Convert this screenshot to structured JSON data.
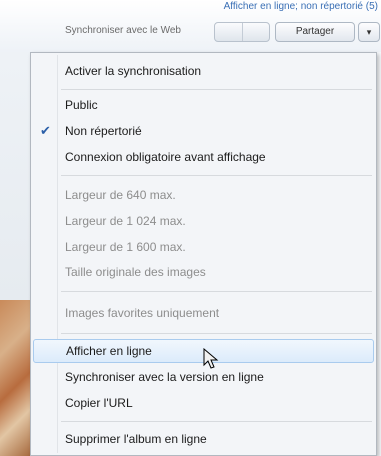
{
  "header": {
    "status_link": "Afficher en ligne; non répertorié (5)",
    "sync_label": "Synchroniser avec le Web",
    "share_button": "Partager",
    "dropdown_icon": "chevron-down-icon"
  },
  "menu": {
    "activate_sync": "Activer la synchronisation",
    "public": "Public",
    "unlisted": "Non répertorié",
    "login_required": "Connexion obligatoire avant affichage",
    "width_640": "Largeur de 640 max.",
    "width_1024": "Largeur de 1 024 max.",
    "width_1600": "Largeur de 1 600 max.",
    "original_size": "Taille originale des images",
    "favorites_only": "Images favorites uniquement",
    "view_online": "Afficher en ligne",
    "sync_online": "Synchroniser avec la version en ligne",
    "copy_url": "Copier l'URL",
    "delete_online": "Supprimer l'album en ligne",
    "check_icon": "check-icon"
  },
  "colors": {
    "link": "#3a6fb5",
    "hover_bg": "#dcebfb",
    "disabled_text": "#8d8d8d"
  }
}
